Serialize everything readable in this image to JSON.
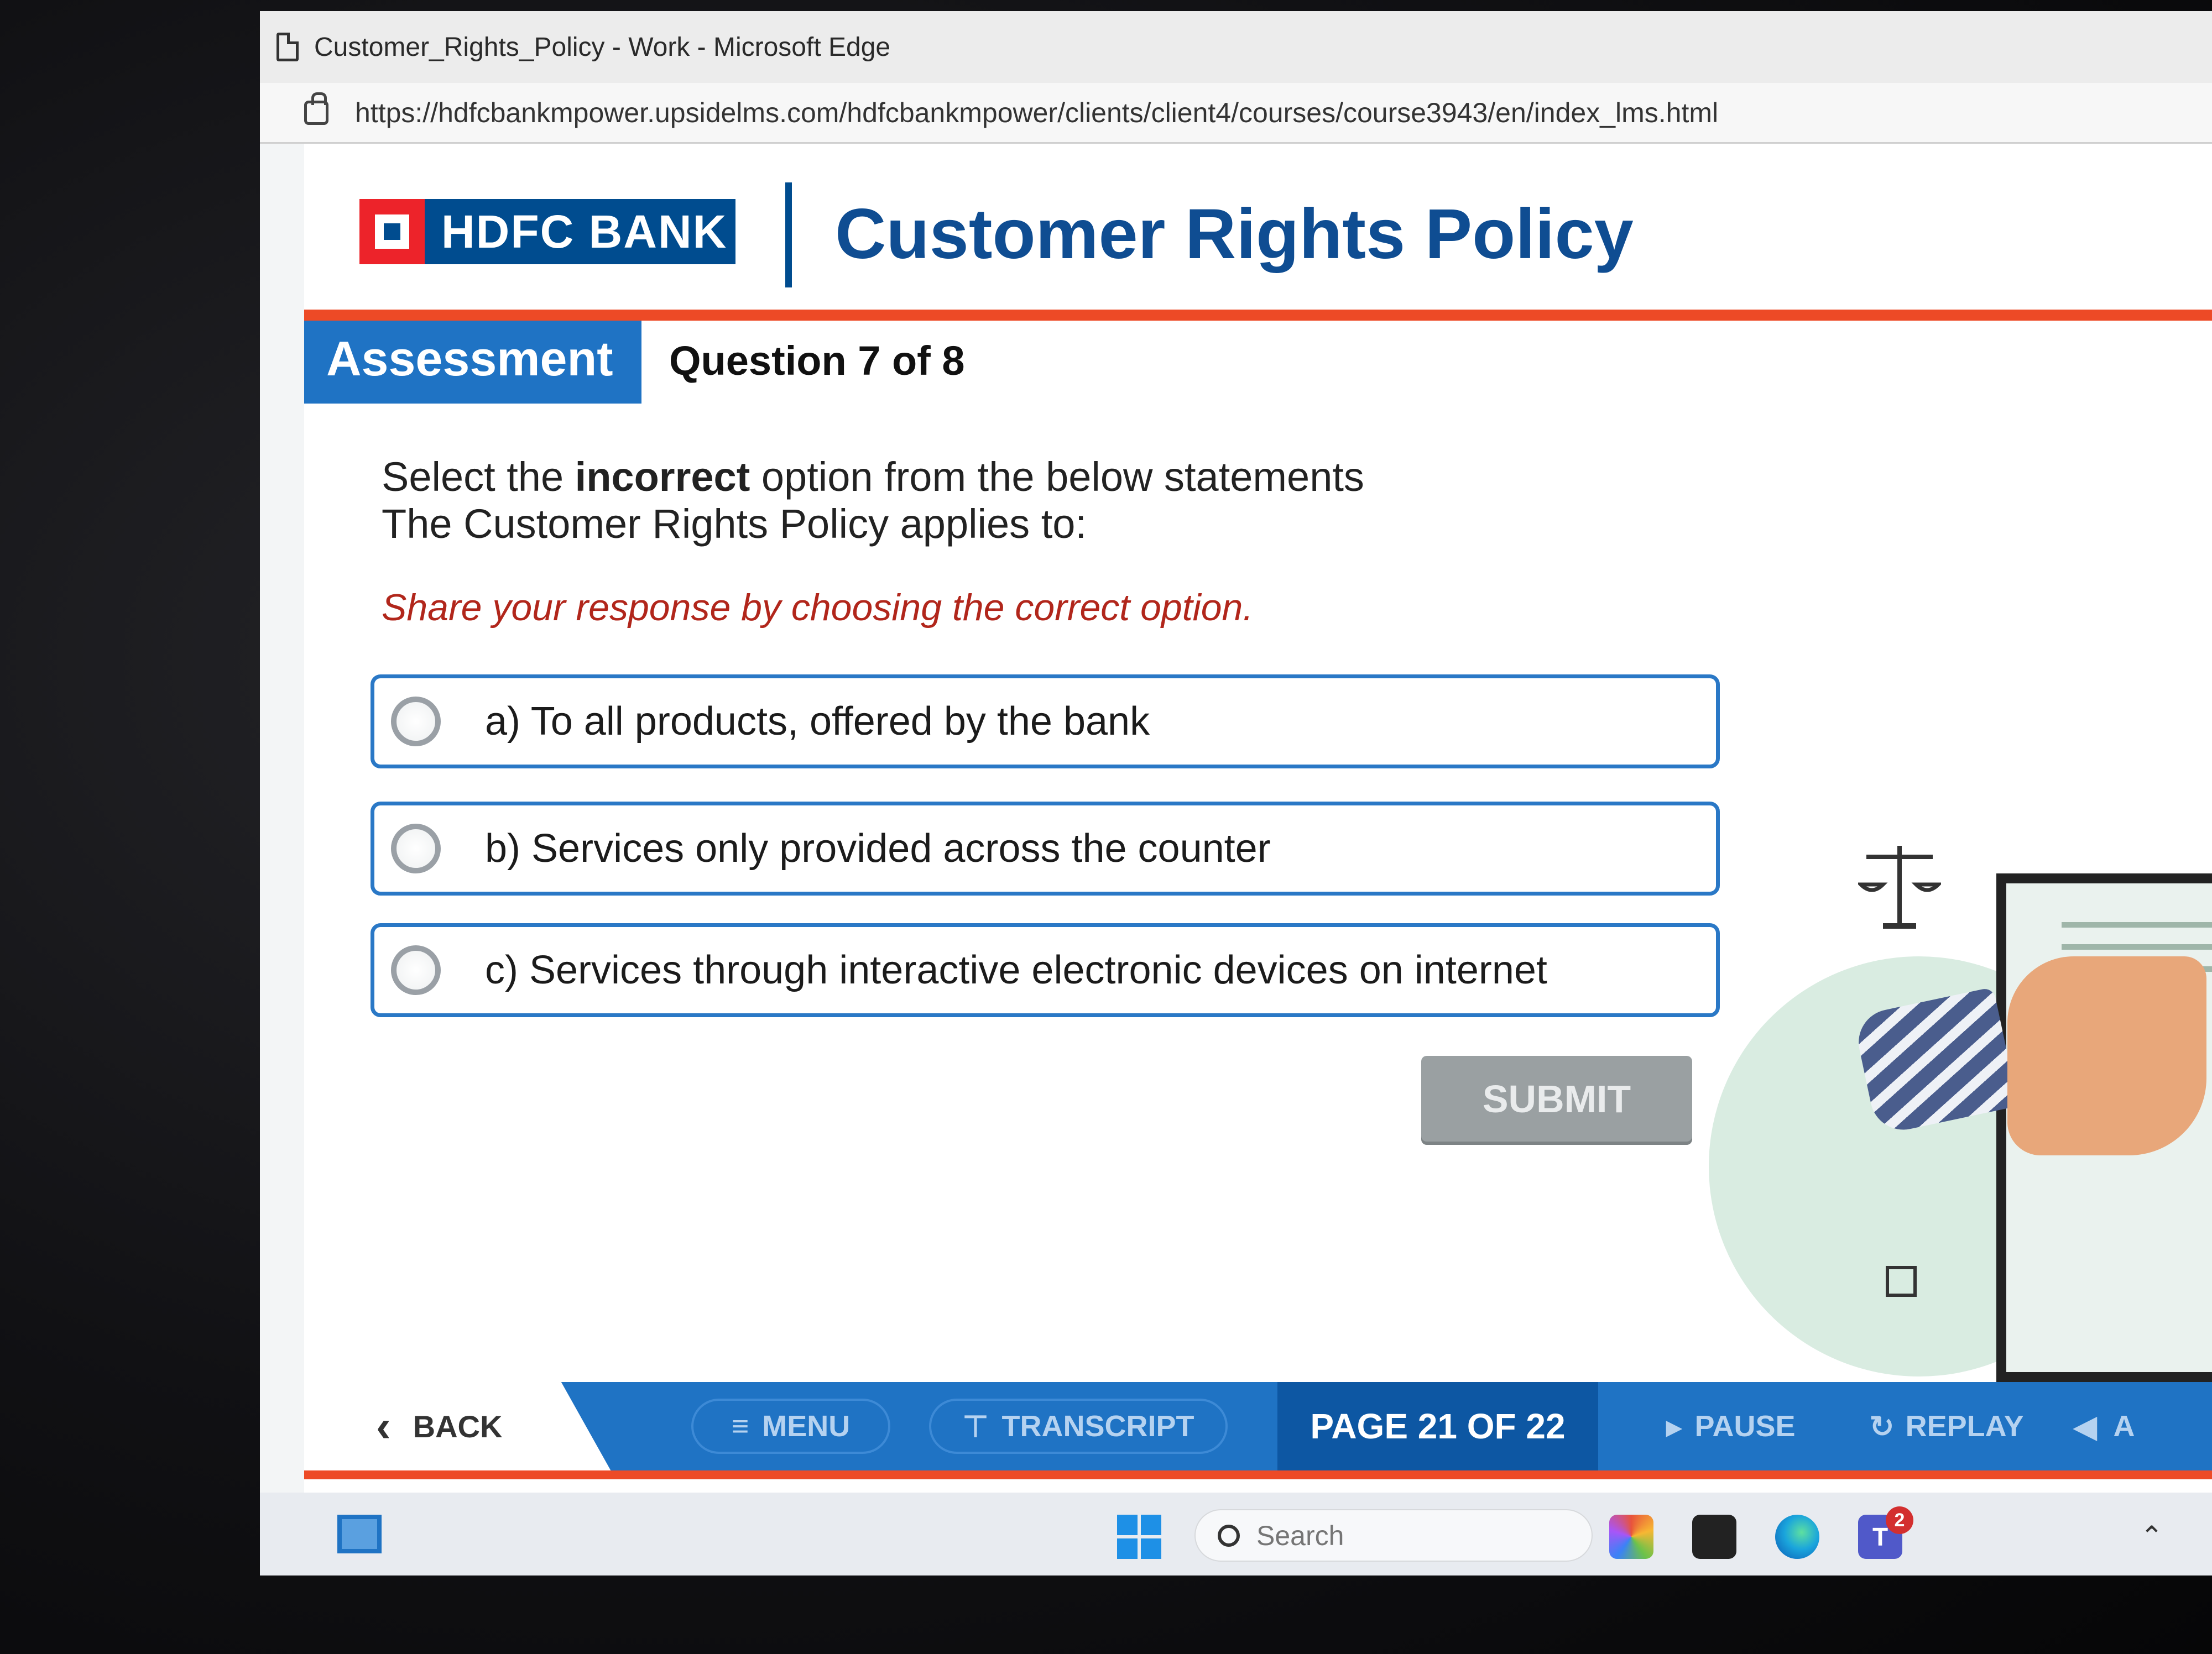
{
  "browser": {
    "window_title": "Customer_Rights_Policy - Work - Microsoft Edge",
    "url": "https://hdfcbankmpower.upsidelms.com/hdfcbankmpower/clients/client4/courses/course3943/en/index_lms.html"
  },
  "course": {
    "brand": "HDFC BANK",
    "title": "Customer Rights Policy",
    "section_tab": "Assessment",
    "question_counter": "Question 7 of 8"
  },
  "question": {
    "line1_pre": "Select the ",
    "line1_bold": "incorrect",
    "line1_post": " option from the below statements",
    "line2": "The Customer Rights Policy applies to:",
    "instruction": "Share your response by choosing the correct option.",
    "options": [
      {
        "label": "a) To all products, offered by the bank",
        "selected": false
      },
      {
        "label": "b) Services only provided across the counter",
        "selected": false
      },
      {
        "label": "c) Services through interactive electronic devices on internet",
        "selected": false
      }
    ],
    "submit_label": "SUBMIT"
  },
  "nav": {
    "back": "BACK",
    "menu": "MENU",
    "transcript": "TRANSCRIPT",
    "page_indicator": "PAGE 21 OF 22",
    "pause": "PAUSE",
    "replay": "REPLAY",
    "audio": "A"
  },
  "taskbar": {
    "search_placeholder": "Search",
    "teams_badge": "2",
    "teams_letter": "T"
  },
  "colors": {
    "brand_blue": "#004c8f",
    "accent_blue": "#1f73c4",
    "rule_red": "#ed4a26",
    "instruction_red": "#b1261b",
    "submit_disabled": "#9aa0a2"
  }
}
